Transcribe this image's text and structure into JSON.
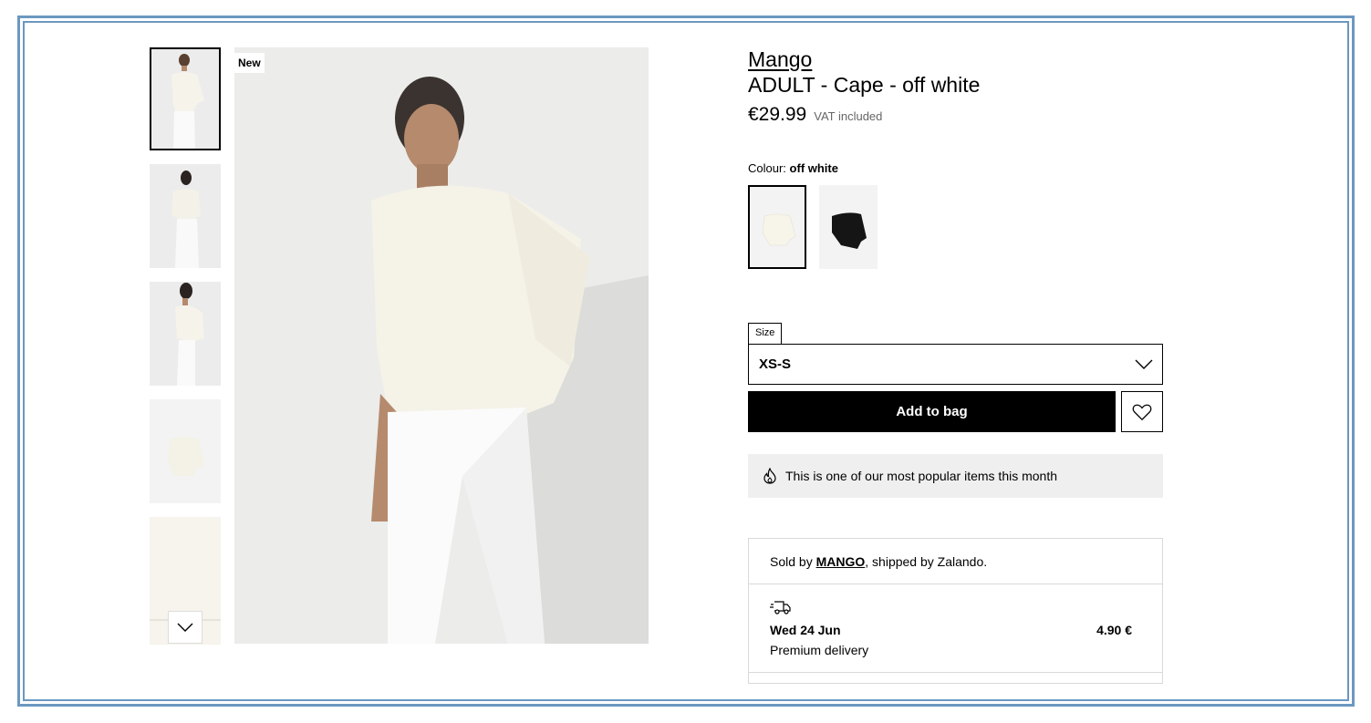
{
  "product": {
    "brand": "Mango",
    "title": "ADULT - Cape - off white",
    "price": "€29.99",
    "vat_note": "VAT included",
    "badge": "New"
  },
  "colour": {
    "label": "Colour:",
    "selected": "off white",
    "options": [
      "off white",
      "black"
    ]
  },
  "size": {
    "label": "Size",
    "selected": "XS-S"
  },
  "actions": {
    "add_to_bag": "Add to bag"
  },
  "popular_note": "This is one of our most popular items this month",
  "seller": {
    "prefix": "Sold by ",
    "name": "MANGO",
    "suffix": ", shipped by Zalando."
  },
  "delivery": {
    "date": "Wed 24 Jun",
    "type": "Premium delivery",
    "price": "4.90 €"
  },
  "icons": {
    "chevron": "chevron-down-icon",
    "wishlist": "heart-icon",
    "popular": "flame-icon",
    "delivery": "truck-icon"
  },
  "colors": {
    "frame": "#6b98c0",
    "primary_button": "#000000",
    "notice_bg": "#efefef"
  }
}
